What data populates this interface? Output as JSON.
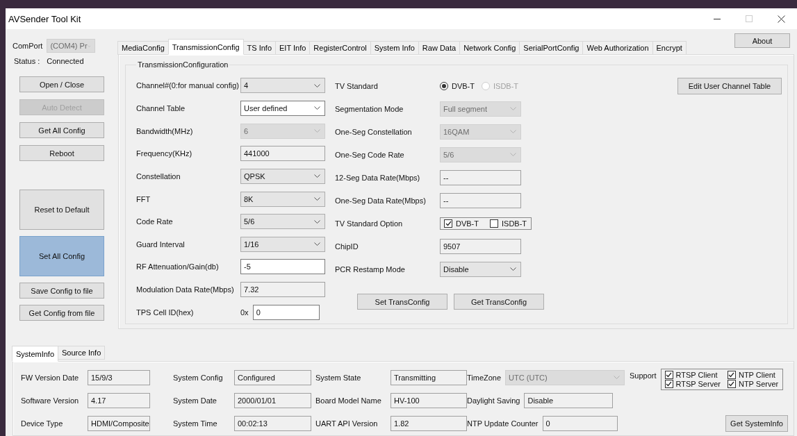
{
  "window": {
    "title": "AVSender Tool Kit"
  },
  "connection": {
    "comport_label": "ComPort",
    "comport": {
      "value": "(COM4) Pr",
      "disabled": true
    },
    "status_label": "Status :",
    "status": "Connected"
  },
  "side_buttons": [
    {
      "label": "Open / Close",
      "disabled": false,
      "selected": false
    },
    {
      "label": "Auto Detect",
      "disabled": true,
      "selected": false
    },
    {
      "label": "Get All Config",
      "disabled": false,
      "selected": false
    },
    {
      "label": "Reboot",
      "disabled": false,
      "selected": false
    }
  ],
  "config_buttons": [
    {
      "label": "Reset to Default",
      "kind": "tall",
      "selected": false
    },
    {
      "label": "Set All Config",
      "kind": "tall",
      "selected": true
    },
    {
      "label": "Save Config to file",
      "kind": "normal",
      "selected": false
    },
    {
      "label": "Get Config from file",
      "kind": "normal",
      "selected": false
    }
  ],
  "about_button": "About",
  "tabs": [
    {
      "label": "MediaConfig",
      "selected": false
    },
    {
      "label": "TransmissionConfig",
      "selected": true
    },
    {
      "label": "TS Info",
      "selected": false
    },
    {
      "label": "EIT Info",
      "selected": false
    },
    {
      "label": "RegisterControl",
      "selected": false
    },
    {
      "label": "System Info",
      "selected": false
    },
    {
      "label": "Raw Data",
      "selected": false
    },
    {
      "label": "Network Config",
      "selected": false
    },
    {
      "label": "SerialPortConfig",
      "selected": false
    },
    {
      "label": "Web Authorization",
      "selected": false
    },
    {
      "label": "Encrypt",
      "selected": false
    }
  ],
  "group_title": "TransmissionConfiguration",
  "left_fields": [
    {
      "label": "Channel#(0:for manual config)",
      "kind": "combo",
      "value": "4",
      "disabled": false,
      "focused": false
    },
    {
      "label": "Channel Table",
      "kind": "combo",
      "value": "User defined",
      "disabled": false,
      "focused": true
    },
    {
      "label": "Bandwidth(MHz)",
      "kind": "combo",
      "value": "6",
      "disabled": true,
      "focused": false
    },
    {
      "label": "Frequency(KHz)",
      "kind": "text",
      "value": "441000",
      "readonly": true
    },
    {
      "label": "Constellation",
      "kind": "combo",
      "value": "QPSK",
      "disabled": false,
      "focused": false
    },
    {
      "label": "FFT",
      "kind": "combo",
      "value": "8K",
      "disabled": false,
      "focused": false
    },
    {
      "label": "Code Rate",
      "kind": "combo",
      "value": "5/6",
      "disabled": false,
      "focused": false
    },
    {
      "label": "Guard Interval",
      "kind": "combo",
      "value": "1/16",
      "disabled": false,
      "focused": false
    },
    {
      "label": "RF Attenuation/Gain(db)",
      "kind": "text",
      "value": "-5",
      "readonly": false
    },
    {
      "label": "Modulation Data Rate(Mbps)",
      "kind": "text",
      "value": "7.32",
      "readonly": true
    },
    {
      "label": "TPS Cell ID(hex)",
      "kind": "text",
      "prefix": "0x",
      "value": "0",
      "readonly": false
    }
  ],
  "right_fields": [
    {
      "label": "TV Standard",
      "kind": "radio",
      "options": [
        {
          "label": "DVB-T",
          "selected": true,
          "disabled": false
        },
        {
          "label": "ISDB-T",
          "selected": false,
          "disabled": true
        }
      ]
    },
    {
      "label": "Segmentation Mode",
      "kind": "combo",
      "value": "Full segment",
      "disabled": true,
      "focused": false
    },
    {
      "label": "One-Seg Constellation",
      "kind": "combo",
      "value": "16QAM",
      "disabled": true,
      "focused": false
    },
    {
      "label": "One-Seg Code Rate",
      "kind": "combo",
      "value": "5/6",
      "disabled": true,
      "focused": false
    },
    {
      "label": "12-Seg Data Rate(Mbps)",
      "kind": "text",
      "value": "--",
      "readonly": true
    },
    {
      "label": "One-Seg Data Rate(Mbps)",
      "kind": "text",
      "value": "--",
      "readonly": true
    },
    {
      "label": "TV Standard Option",
      "kind": "checks",
      "options": [
        {
          "label": "DVB-T",
          "checked": true
        },
        {
          "label": "ISDB-T",
          "checked": false
        }
      ]
    },
    {
      "label": "ChipID",
      "kind": "text",
      "value": "9507",
      "readonly": true
    },
    {
      "label": "PCR Restamp Mode",
      "kind": "combo",
      "value": "Disable",
      "disabled": false,
      "focused": false
    }
  ],
  "trans_buttons": [
    "Set TransConfig",
    "Get TransConfig"
  ],
  "edit_channel_button": "Edit User Channel Table",
  "bottom_tabs": [
    {
      "label": "SystemInfo",
      "selected": true
    },
    {
      "label": "Source Info",
      "selected": false
    }
  ],
  "system_info": [
    [
      {
        "label": "FW Version Date",
        "value": "15/9/3"
      },
      {
        "label": "System Config",
        "value": "Configured"
      },
      {
        "label": "System State",
        "value": "Transmitting"
      },
      {
        "label": "TimeZone",
        "value": "UTC (UTC)",
        "kind": "combo",
        "disabled": true
      }
    ],
    [
      {
        "label": "Software Version",
        "value": "4.17"
      },
      {
        "label": "System Date",
        "value": "2000/01/01"
      },
      {
        "label": "Board Model Name",
        "value": "HV-100"
      },
      {
        "label": "Daylight Saving",
        "value": "Disable"
      }
    ],
    [
      {
        "label": "Device Type",
        "value": "HDMI/Composite"
      },
      {
        "label": "System Time",
        "value": "00:02:13"
      },
      {
        "label": "UART API Version",
        "value": "1.82"
      },
      {
        "label": "NTP Update Counter",
        "value": "0"
      }
    ]
  ],
  "support": {
    "label": "Support",
    "options": [
      {
        "label": "RTSP Client",
        "checked": true
      },
      {
        "label": "NTP Client",
        "checked": true
      },
      {
        "label": "RTSP Server",
        "checked": true
      },
      {
        "label": "NTP Server",
        "checked": true
      }
    ]
  },
  "get_systeminfo_button": "Get SystemInfo"
}
